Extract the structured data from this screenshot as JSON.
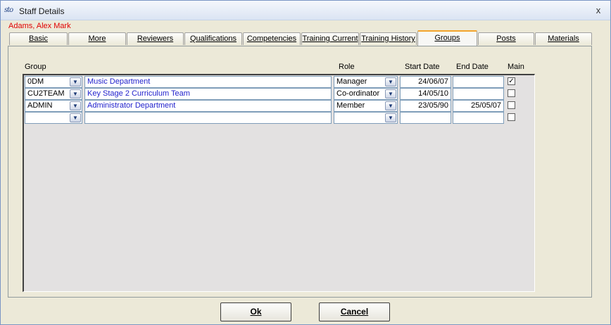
{
  "window": {
    "title": "Staff Details",
    "close_glyph": "x",
    "app_icon_text": "sto"
  },
  "staff_name": "Adams, Alex Mark",
  "tabs": [
    {
      "label": "Basic"
    },
    {
      "label": "More"
    },
    {
      "label": "Reviewers"
    },
    {
      "label": "Qualifications"
    },
    {
      "label": "Competencies"
    },
    {
      "label": "Training Current"
    },
    {
      "label": "Training History"
    },
    {
      "label": "Groups",
      "active": true
    },
    {
      "label": "Posts"
    },
    {
      "label": "Materials"
    }
  ],
  "columns": {
    "group": "Group",
    "role": "Role",
    "start_date": "Start Date",
    "end_date": "End Date",
    "main": "Main"
  },
  "rows": [
    {
      "group": "0DM",
      "description": "Music Department",
      "role": "Manager",
      "start_date": "24/06/07",
      "end_date": "",
      "main": true
    },
    {
      "group": "CU2TEAM",
      "description": "Key Stage 2 Curriculum Team",
      "role": "Co-ordinator",
      "start_date": "14/05/10",
      "end_date": "",
      "main": false
    },
    {
      "group": "ADMIN",
      "description": "Administrator Department",
      "role": "Member",
      "start_date": "23/05/90",
      "end_date": "25/05/07",
      "main": false
    },
    {
      "group": "",
      "description": "",
      "role": "",
      "start_date": "",
      "end_date": "",
      "main": false
    }
  ],
  "buttons": {
    "ok": "Ok",
    "cancel": "Cancel"
  },
  "icons": {
    "dropdown": "chevron-down-icon",
    "checkmark": "checkmark-icon",
    "close": "close-icon"
  },
  "colors": {
    "staff_name": "#e00000",
    "description_text": "#2222cc",
    "active_tab_accent": "#f3a42c"
  }
}
